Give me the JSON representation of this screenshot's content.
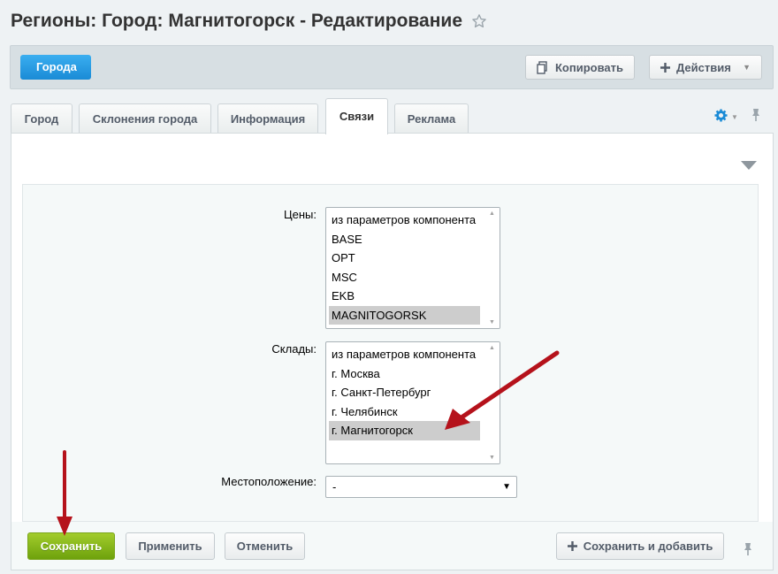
{
  "page": {
    "title": "Регионы: Город: Магнитогорск - Редактирование"
  },
  "toolbar": {
    "back_label": "Города",
    "copy_label": "Копировать",
    "actions_label": "Действия"
  },
  "tabs": [
    {
      "label": "Город"
    },
    {
      "label": "Склонения города"
    },
    {
      "label": "Информация"
    },
    {
      "label": "Связи",
      "active": true
    },
    {
      "label": "Реклама"
    }
  ],
  "form": {
    "prices": {
      "label": "Цены:",
      "options": [
        "из параметров компонента",
        "BASE",
        "OPT",
        "MSC",
        "EKB",
        "MAGNITOGORSK"
      ],
      "selected": "MAGNITOGORSK"
    },
    "warehouses": {
      "label": "Склады:",
      "options": [
        "из параметров компонента",
        "г. Москва",
        "г. Санкт-Петербург",
        "г. Челябинск",
        "г. Магнитогорск"
      ],
      "selected": "г. Магнитогорск"
    },
    "location": {
      "label": "Местоположение:",
      "value": "-"
    }
  },
  "footer": {
    "save_label": "Сохранить",
    "apply_label": "Применить",
    "cancel_label": "Отменить",
    "save_add_label": "Сохранить и добавить"
  },
  "colors": {
    "accent_blue": "#1a8bd6",
    "save_green": "#8bbd1d",
    "annotation_red": "#b5121b"
  }
}
